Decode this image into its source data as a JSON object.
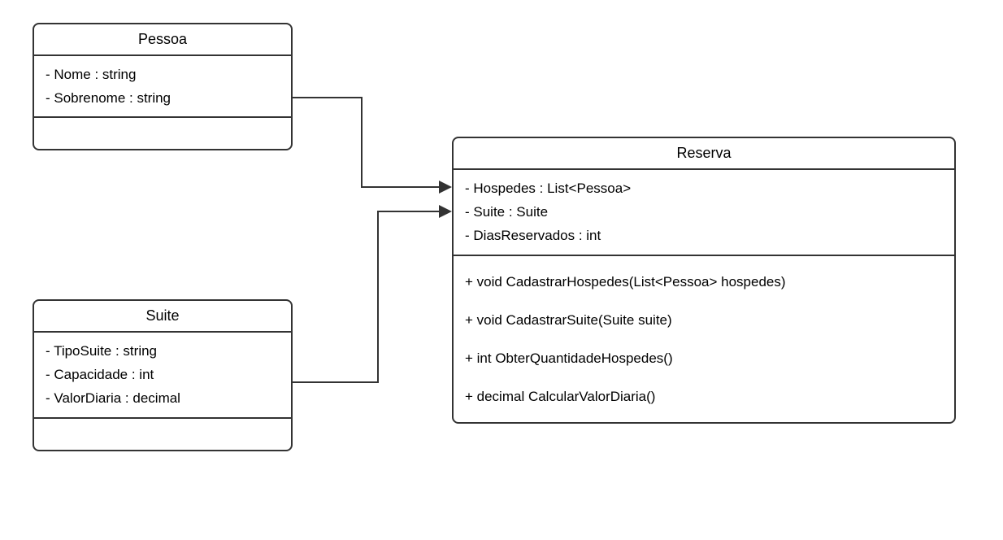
{
  "classes": {
    "pessoa": {
      "name": "Pessoa",
      "attributes": [
        "- Nome : string",
        "- Sobrenome : string"
      ],
      "methods": []
    },
    "suite": {
      "name": "Suite",
      "attributes": [
        "- TipoSuite : string",
        "- Capacidade : int",
        "- ValorDiaria : decimal"
      ],
      "methods": []
    },
    "reserva": {
      "name": "Reserva",
      "attributes": [
        "- Hospedes : List<Pessoa>",
        "- Suite : Suite",
        "- DiasReservados : int"
      ],
      "methods": [
        "+ void CadastrarHospedes(List<Pessoa> hospedes)",
        "+ void CadastrarSuite(Suite suite)",
        "+ int ObterQuantidadeHospedes()",
        "+ decimal CalcularValorDiaria()"
      ]
    }
  },
  "chart_data": {
    "type": "uml-class-diagram",
    "classes": [
      {
        "name": "Pessoa",
        "attributes": [
          {
            "visibility": "-",
            "name": "Nome",
            "type": "string"
          },
          {
            "visibility": "-",
            "name": "Sobrenome",
            "type": "string"
          }
        ],
        "methods": []
      },
      {
        "name": "Suite",
        "attributes": [
          {
            "visibility": "-",
            "name": "TipoSuite",
            "type": "string"
          },
          {
            "visibility": "-",
            "name": "Capacidade",
            "type": "int"
          },
          {
            "visibility": "-",
            "name": "ValorDiaria",
            "type": "decimal"
          }
        ],
        "methods": []
      },
      {
        "name": "Reserva",
        "attributes": [
          {
            "visibility": "-",
            "name": "Hospedes",
            "type": "List<Pessoa>"
          },
          {
            "visibility": "-",
            "name": "Suite",
            "type": "Suite"
          },
          {
            "visibility": "-",
            "name": "DiasReservados",
            "type": "int"
          }
        ],
        "methods": [
          {
            "visibility": "+",
            "return": "void",
            "name": "CadastrarHospedes",
            "params": "List<Pessoa> hospedes"
          },
          {
            "visibility": "+",
            "return": "void",
            "name": "CadastrarSuite",
            "params": "Suite suite"
          },
          {
            "visibility": "+",
            "return": "int",
            "name": "ObterQuantidadeHospedes",
            "params": ""
          },
          {
            "visibility": "+",
            "return": "decimal",
            "name": "CalcularValorDiaria",
            "params": ""
          }
        ]
      }
    ],
    "relationships": [
      {
        "from": "Pessoa",
        "to": "Reserva",
        "type": "association-directed"
      },
      {
        "from": "Suite",
        "to": "Reserva",
        "type": "association-directed"
      }
    ]
  }
}
